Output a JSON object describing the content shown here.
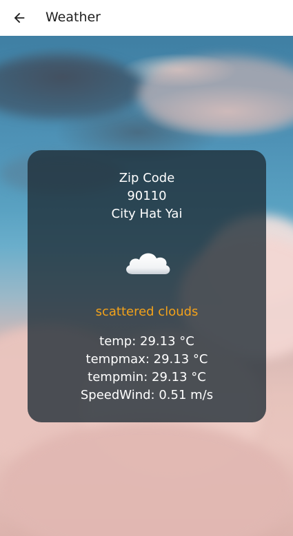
{
  "appbar": {
    "title": "Weather",
    "back_icon": "arrow-back-icon"
  },
  "card": {
    "zip_label": "Zip Code",
    "zip_value": "90110",
    "city": "City Hat Yai",
    "icon": "cloud-icon",
    "description": "scattered clouds",
    "temp": "temp: 29.13 °C",
    "tempmax": "tempmax: 29.13 °C",
    "tempmin": "tempmin: 29.13 °C",
    "speed_wind": "SpeedWind: 0.51 m/s"
  },
  "colors": {
    "description": "#f3a21a",
    "card_bg": "#1e2c34"
  }
}
